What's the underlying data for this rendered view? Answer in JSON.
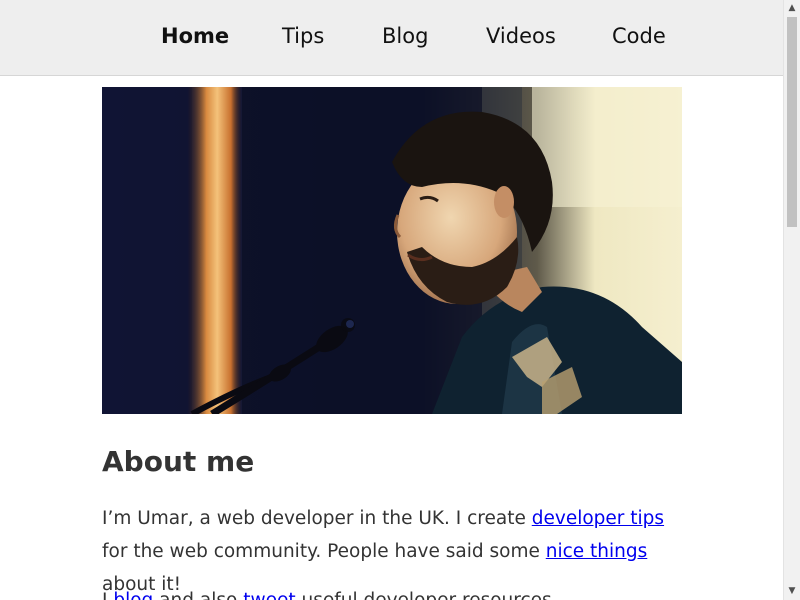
{
  "nav": {
    "items": [
      {
        "label": "Home",
        "active": true
      },
      {
        "label": "Tips",
        "active": false
      },
      {
        "label": "Blog",
        "active": false
      },
      {
        "label": "Videos",
        "active": false
      },
      {
        "label": "Code",
        "active": false
      }
    ]
  },
  "hero": {
    "icon": "portrait-photo",
    "description_colors": [
      "#1b1a33",
      "#f1ecc8",
      "#0f2a3a"
    ]
  },
  "about": {
    "heading": "About me",
    "p1": {
      "t1": "I’m Umar, a web developer in the UK. I create ",
      "link1": "developer tips",
      "t2": " for the web community. People have said some ",
      "link2": "nice things",
      "t3": " about it!"
    },
    "p2": {
      "t1": "I ",
      "link1": "blog",
      "t2": " and also ",
      "link2": "tweet",
      "t3": " useful developer resources."
    }
  },
  "colors": {
    "nav_bg": "#eeeeee",
    "link": "#0000ee",
    "text": "#333333"
  }
}
